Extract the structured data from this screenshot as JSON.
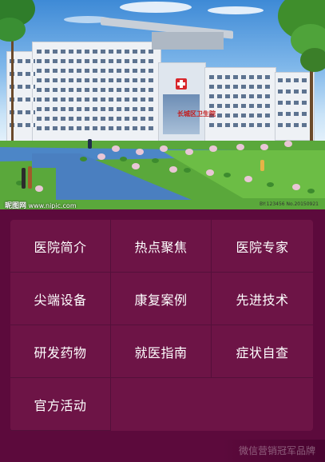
{
  "hero": {
    "image_description_icon": "hospital-building-photo",
    "building_sign": "长城区卫生院",
    "watermark_site": "昵图网",
    "watermark_url": "www.nipic.com",
    "watermark_code": "BY:123456  No.20150921"
  },
  "menu": {
    "items": [
      {
        "label": "医院简介"
      },
      {
        "label": "热点聚焦"
      },
      {
        "label": "医院专家"
      },
      {
        "label": "尖端设备"
      },
      {
        "label": "康复案例"
      },
      {
        "label": "先进技术"
      },
      {
        "label": "研发药物"
      },
      {
        "label": "就医指南"
      },
      {
        "label": "症状自查"
      },
      {
        "label": "官方活动"
      }
    ]
  },
  "footer": {
    "watermark": "微信营销冠军品牌"
  },
  "colors": {
    "page_bg": "#5c0a3c",
    "panel_bg": "#6d1446",
    "divider": "#54103a",
    "text": "#ffffff"
  }
}
